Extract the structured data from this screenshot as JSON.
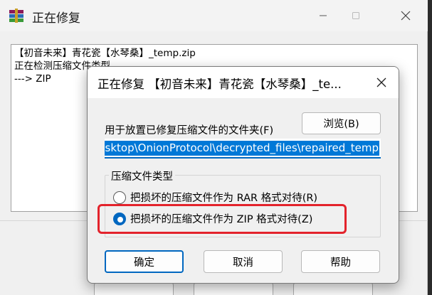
{
  "main_window": {
    "title": "正在修复",
    "log_lines": [
      "【初音未来】青花瓷【水琴桑】_temp.zip",
      "正在检测压缩文件类型",
      "---> ZIP"
    ]
  },
  "dialog": {
    "title": "正在修复 【初音未来】青花瓷【水琴桑】_te...",
    "folder_label": "用于放置已修复压缩文件的文件夹(F)",
    "browse_label": "浏览(B)",
    "path_value": "Desktop\\OnionProtocol\\decrypted_files\\repaired_temp",
    "group_title": "压缩文件类型",
    "radio_options": [
      {
        "label": "把损坏的压缩文件作为 RAR 格式对待(R)",
        "checked": false
      },
      {
        "label": "把损坏的压缩文件作为 ZIP 格式对待(Z)",
        "checked": true
      }
    ],
    "ok_label": "确定",
    "cancel_label": "取消",
    "help_label": "帮助"
  },
  "colors": {
    "accent": "#0067c0",
    "highlight": "#e3232c",
    "selection": "#0078d7"
  }
}
